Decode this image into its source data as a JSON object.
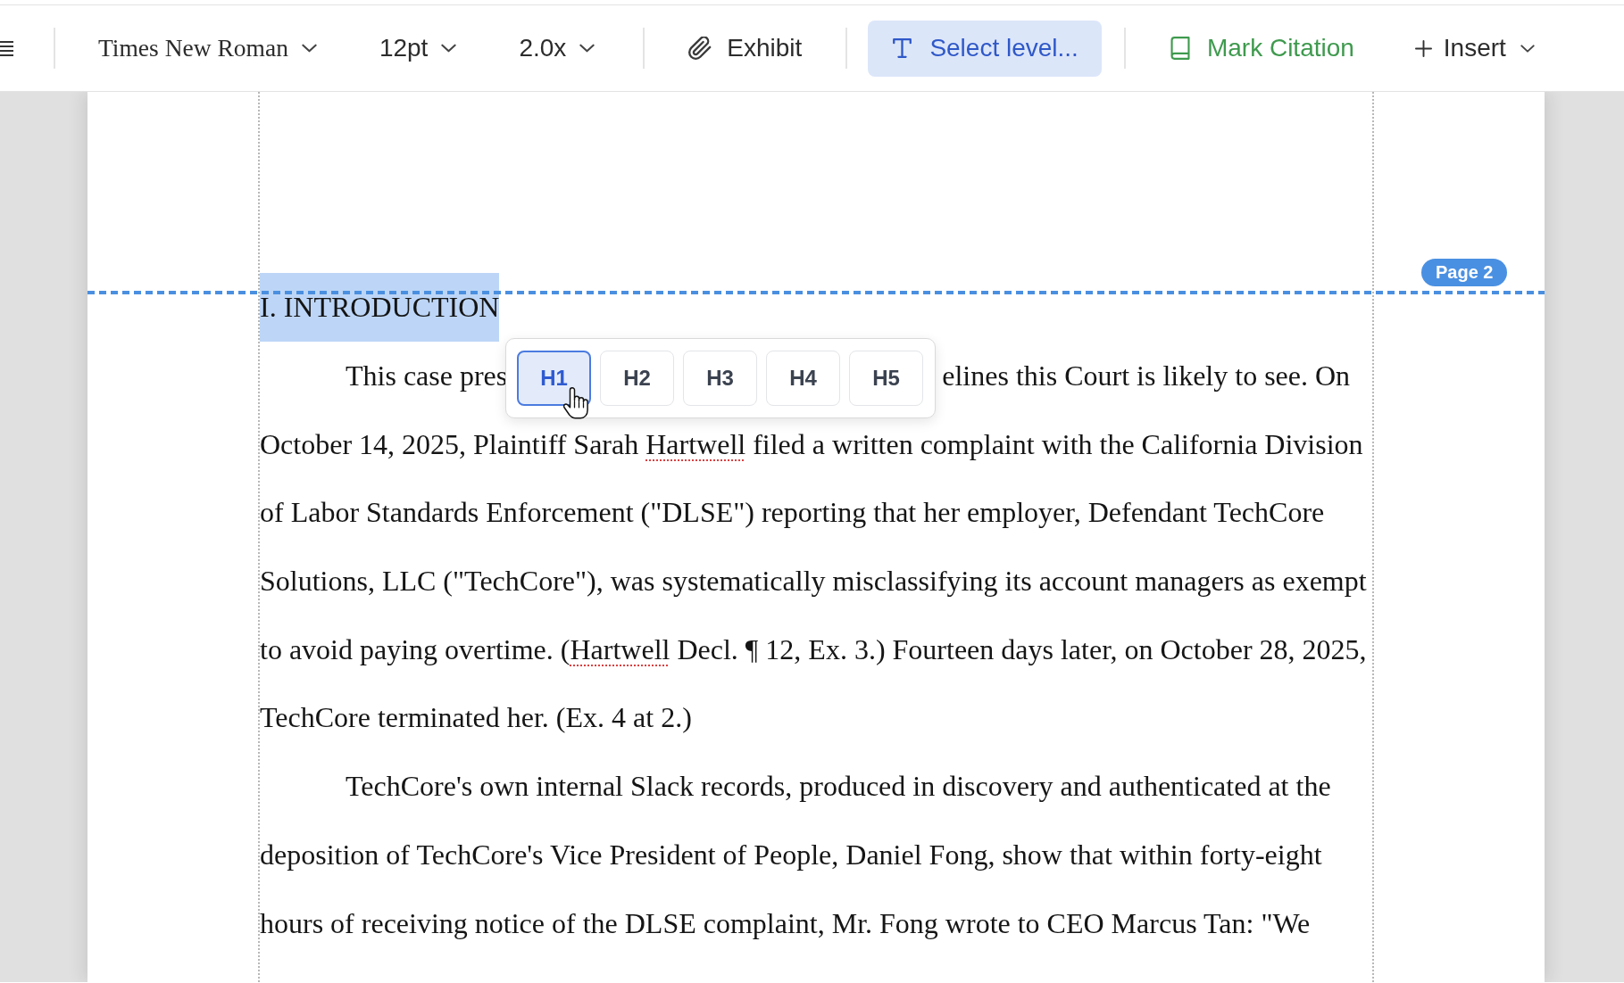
{
  "toolbar": {
    "font_family": {
      "label": "Times New Roman"
    },
    "font_size": {
      "label": "12pt"
    },
    "line_spacing": {
      "label": "2.0x"
    },
    "exhibit": {
      "label": "Exhibit"
    },
    "heading_level": {
      "label": "Select level...",
      "active": true
    },
    "mark_citation": {
      "label": "Mark Citation"
    },
    "insert": {
      "label": "Insert"
    }
  },
  "document": {
    "page_break": {
      "label": "Page 2"
    },
    "heading": {
      "text": "I. INTRODUCTION",
      "selected": true
    },
    "blocks": [
      {
        "kind": "covered_line",
        "parts": [
          "This case pres",
          "elines this Court is likely to see. On"
        ]
      },
      {
        "kind": "paragraph",
        "indent": false,
        "lines": [
          {
            "segments": [
              {
                "text": "October 14, 2025, Plaintiff Sarah ",
                "flagged": false
              },
              {
                "text": "Hartwell",
                "flagged": true
              },
              {
                "text": " filed a written complaint with the California Division",
                "flagged": false
              }
            ]
          },
          {
            "segments": [
              {
                "text": "of Labor Standards Enforcement (\"DLSE\") reporting that her employer, Defendant TechCore",
                "flagged": false
              }
            ]
          },
          {
            "segments": [
              {
                "text": "Solutions, LLC (\"TechCore\"), was systematically misclassifying its account managers as exempt",
                "flagged": false
              }
            ]
          },
          {
            "segments": [
              {
                "text": "to avoid paying overtime. (",
                "flagged": false
              },
              {
                "text": "Hartwell",
                "flagged": true
              },
              {
                "text": " Decl. ¶ 12, Ex. 3.) Fourteen days later, on October 28, 2025,",
                "flagged": false
              }
            ]
          },
          {
            "segments": [
              {
                "text": "TechCore terminated her. (Ex. 4 at 2.)",
                "flagged": false
              }
            ]
          }
        ]
      },
      {
        "kind": "paragraph",
        "indent": true,
        "lines": [
          {
            "segments": [
              {
                "text": "TechCore's own internal Slack records, produced in discovery and authenticated at the",
                "flagged": false
              }
            ]
          },
          {
            "segments": [
              {
                "text": "deposition of TechCore's Vice President of People, Daniel Fong, show that within forty-eight",
                "flagged": false
              }
            ]
          },
          {
            "segments": [
              {
                "text": "hours of receiving notice of the DLSE complaint, Mr. Fong wrote to CEO Marcus Tan: \"We",
                "flagged": false
              }
            ]
          }
        ]
      }
    ]
  },
  "heading_level_popup": {
    "options": [
      {
        "label": "H1",
        "selected": true,
        "hovered": true
      },
      {
        "label": "H2",
        "selected": false,
        "hovered": false
      },
      {
        "label": "H3",
        "selected": false,
        "hovered": false
      },
      {
        "label": "H4",
        "selected": false,
        "hovered": false
      },
      {
        "label": "H5",
        "selected": false,
        "hovered": false
      }
    ]
  }
}
